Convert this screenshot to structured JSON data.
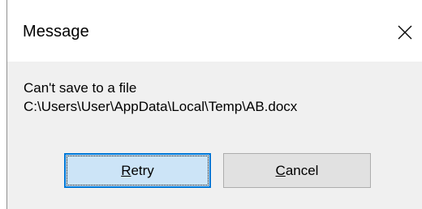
{
  "dialog": {
    "title": "Message",
    "close_icon": "close-icon",
    "message_line1": "Can't save to a file",
    "message_line2": "C:\\Users\\User\\AppData\\Local\\Temp\\AB.docx"
  },
  "buttons": {
    "retry": {
      "mnemonic": "R",
      "rest": "etry"
    },
    "cancel": {
      "mnemonic": "C",
      "rest": "ancel"
    }
  },
  "colors": {
    "default_button_bg": "#cce4f7",
    "default_button_border": "#0078d7",
    "button_bg": "#e1e1e1",
    "dialog_bg": "#f0f0f0"
  }
}
